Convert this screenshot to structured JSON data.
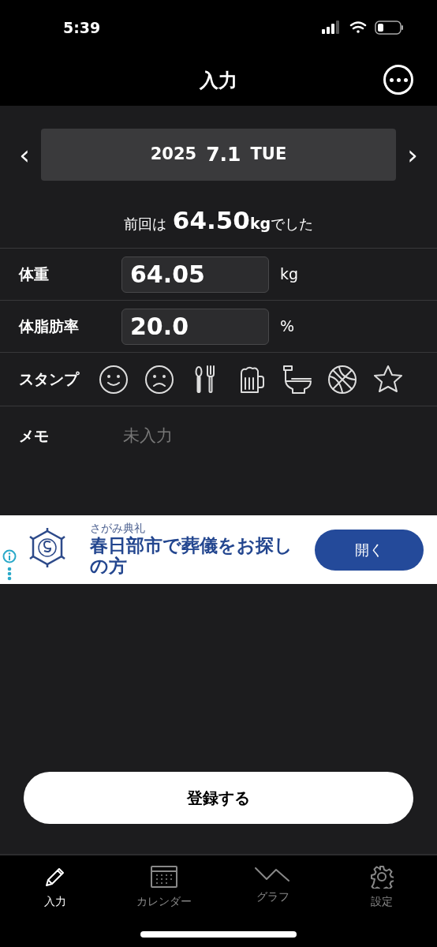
{
  "status_bar": {
    "time": "5:39"
  },
  "header": {
    "title": "入力"
  },
  "date_bar": {
    "prev": "‹",
    "year": "2025",
    "date": "7.1",
    "weekday": "TUE",
    "next": "›"
  },
  "previous": {
    "prefix": "前回は",
    "value": "64.50",
    "unit": "kg",
    "suffix": "でした"
  },
  "fields": [
    {
      "label": "体重",
      "value": "64.05",
      "unit": "kg"
    },
    {
      "label": "体脂肪率",
      "value": "20.0",
      "unit": "%"
    }
  ],
  "stamps": {
    "label": "スタンプ",
    "items": [
      {
        "kind": "smile"
      },
      {
        "kind": "frown"
      },
      {
        "kind": "cutlery"
      },
      {
        "kind": "beer"
      },
      {
        "kind": "toilet"
      },
      {
        "kind": "ball"
      },
      {
        "kind": "star"
      }
    ]
  },
  "memo": {
    "label": "メモ",
    "placeholder": "未入力"
  },
  "ad": {
    "advertiser": "さがみ典礼",
    "headline": "春日部市で葬儀をお探しの方",
    "button": "開く"
  },
  "register_button": "登録する",
  "tabs": [
    {
      "label": "入力",
      "kind": "pencil",
      "selected": true
    },
    {
      "label": "カレンダー",
      "kind": "calendar",
      "selected": false
    },
    {
      "label": "グラフ",
      "kind": "graph",
      "selected": false
    },
    {
      "label": "設定",
      "kind": "gear",
      "selected": false
    }
  ]
}
